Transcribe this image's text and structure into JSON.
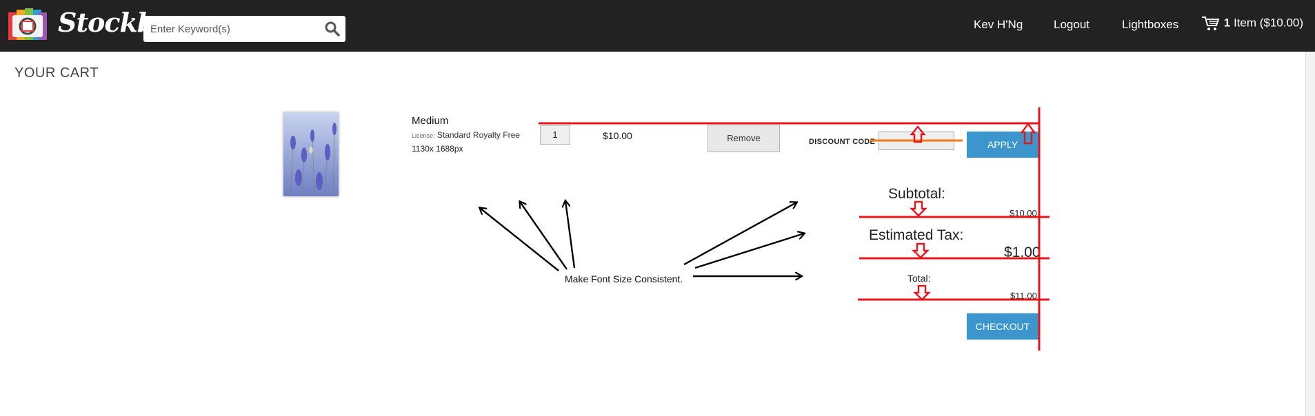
{
  "header": {
    "logo_text": "Stockbo",
    "search": {
      "placeholder": "Enter Keyword(s)",
      "value": ""
    },
    "nav": {
      "user": "Kev H'Ng",
      "logout": "Logout",
      "lightboxes": "Lightboxes",
      "cart_count": "1",
      "cart_label": "Item ($10.00)"
    }
  },
  "page": {
    "title": "YOUR CART"
  },
  "cart": {
    "item": {
      "size": "Medium",
      "license_label": "License:",
      "license": "Standard Royalty Free",
      "dimensions": "1130x 1688px",
      "quantity": "1",
      "price": "$10.00",
      "remove_label": "Remove"
    },
    "discount": {
      "label": "DISCOUNT CODE",
      "value": "",
      "apply_label": "APPLY"
    },
    "summary": {
      "subtotal_label": "Subtotal:",
      "subtotal_value": "$10.00",
      "tax_label": "Estimated Tax:",
      "tax_value": "$1.00",
      "total_label": "Total:",
      "total_value": "$11.00"
    },
    "checkout_label": "CHECKOUT"
  },
  "annotations": {
    "note": "Make Font Size Consistent.",
    "red_color": "#e8141b",
    "orange_color": "#f07c1c",
    "arrow_color": "#000000"
  },
  "colors": {
    "header_bg": "#222222",
    "button_blue": "#3a96cc"
  }
}
